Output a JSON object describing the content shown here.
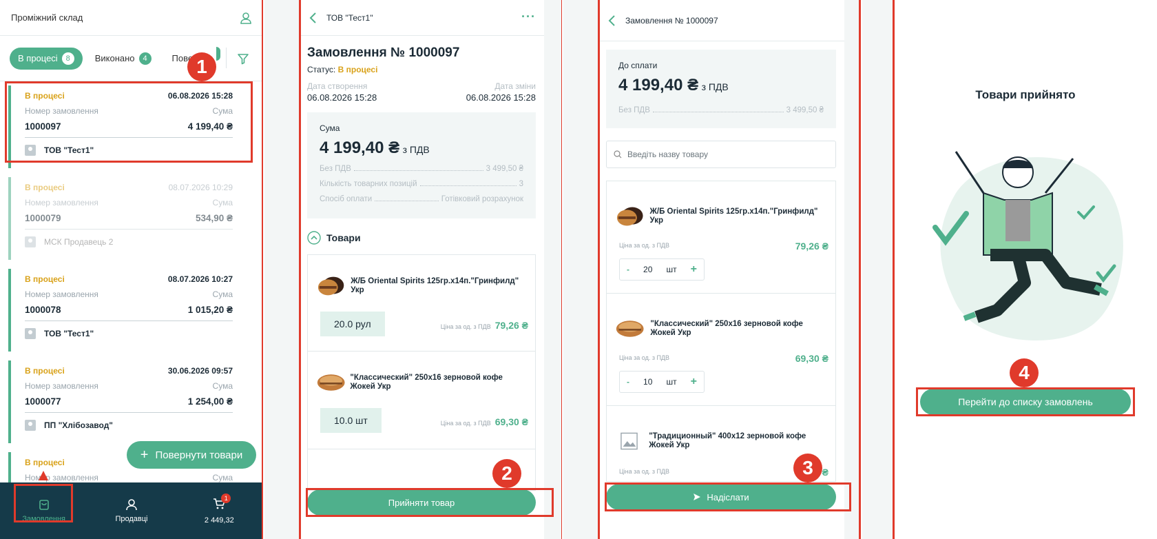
{
  "colors": {
    "accent": "#4fb08c",
    "dark": "#153a49",
    "annotation": "#e03a2b",
    "status": "#d9a21a"
  },
  "p1": {
    "title": "Проміжний склад",
    "tabs": [
      {
        "label": "В процесі",
        "count": "8"
      },
      {
        "label": "Виконано",
        "count": "4"
      },
      {
        "label": "Пове"
      }
    ],
    "orders": [
      {
        "status": "В процесі",
        "date": "06.08.2026 15:28",
        "num_label": "Номер замовлення",
        "sum_label": "Сума",
        "number": "1000097",
        "sum": "4 199,40 ₴",
        "seller": "ТОВ \"Тест1\""
      },
      {
        "status": "В процесі",
        "date": "08.07.2026 10:29",
        "num_label": "Номер замовлення",
        "sum_label": "Сума",
        "number": "1000079",
        "sum": "534,90 ₴",
        "seller": "МСК Продавець 2"
      },
      {
        "status": "В процесі",
        "date": "08.07.2026 10:27",
        "num_label": "Номер замовлення",
        "sum_label": "Сума",
        "number": "1000078",
        "sum": "1 015,20 ₴",
        "seller": "ТОВ \"Тест1\""
      },
      {
        "status": "В процесі",
        "date": "30.06.2026 09:57",
        "num_label": "Номер замовлення",
        "sum_label": "Сума",
        "number": "1000077",
        "sum": "1 254,00 ₴",
        "seller": "ПП \"Хлібозавод\""
      },
      {
        "status": "В процесі",
        "num_label": "Номер замовлення",
        "sum_label": "Сума"
      }
    ],
    "return_btn": "Повернути товари",
    "nav": {
      "orders": "Замовлення",
      "sellers": "Продавці",
      "cart": "2 449,32",
      "cart_badge": "1"
    }
  },
  "p2": {
    "header": "ТОВ \"Тест1\"",
    "title": "Замовлення № 1000097",
    "status_label": "Статус:",
    "status": "В процесі",
    "created_label": "Дата створення",
    "created": "06.08.2026 15:28",
    "changed_label": "Дата зміни",
    "changed": "06.08.2026 15:28",
    "sum_label": "Сума",
    "sum": "4 199,40 ₴",
    "vat": "з ПДВ",
    "rows": [
      {
        "label": "Без ПДВ",
        "value": "3 499,50 ₴"
      },
      {
        "label": "Кількість товарних позицій",
        "value": "3"
      },
      {
        "label": "Спосіб оплати",
        "value": "Готівковий розрахунок"
      }
    ],
    "goods_label": "Товари",
    "products": [
      {
        "name": "Ж/Б Oriental Spirits 125гр.х14п.\"Гринфилд\" Укр",
        "qty": "20.0 рул",
        "price_label": "Ціна за од. з ПДВ",
        "price": "79,26 ₴"
      },
      {
        "name": "\"Классический\"  250х16 зерновой кофе Жокей Укр",
        "qty": "10.0 шт",
        "price_label": "Ціна за од. з ПДВ",
        "price": "69,30 ₴"
      }
    ],
    "accept_btn": "Прийняти товар"
  },
  "p3": {
    "header": "Замовлення № 1000097",
    "pay_label": "До сплати",
    "sum": "4 199,40 ₴",
    "vat": "з ПДВ",
    "no_vat_label": "Без ПДВ",
    "no_vat": "3 499,50 ₴",
    "search_placeholder": "Введіть назву товару",
    "products": [
      {
        "name": "Ж/Б Oriental Spirits 125гр.х14п.\"Гринфилд\" Укр",
        "price_label": "Ціна за од. з ПДВ",
        "price": "79,26 ₴",
        "qty": "20",
        "unit": "шт"
      },
      {
        "name": "\"Классический\"  250х16 зерновой кофе Жокей Укр",
        "price_label": "Ціна за од. з ПДВ",
        "price": "69,30 ₴",
        "qty": "10",
        "unit": "шт"
      },
      {
        "name": "\"Традиционный\"  400х12 зерновой кофе Жокей Укр",
        "price_label": "Ціна за од. з ПДВ",
        "price": "06 ₴"
      }
    ],
    "send_btn": "Надіслати"
  },
  "p4": {
    "title": "Товари прийнято",
    "btn": "Перейти до списку замовлень"
  },
  "markers": [
    "1",
    "2",
    "3",
    "4"
  ]
}
